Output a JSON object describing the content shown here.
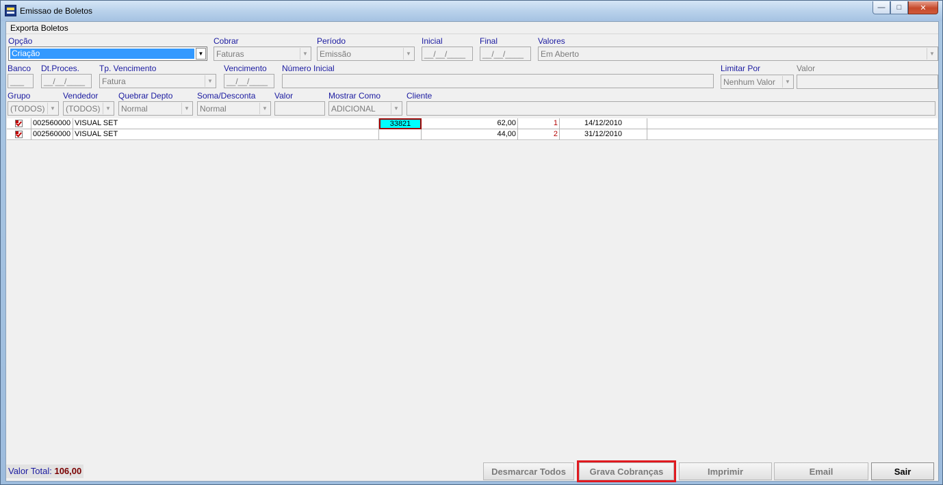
{
  "window": {
    "title": "Emissao de Boletos"
  },
  "menu": {
    "items": [
      {
        "label": "Exporta Boletos"
      }
    ]
  },
  "filters": {
    "opcao": {
      "label": "Opção",
      "value": "Criação"
    },
    "cobrar": {
      "label": "Cobrar",
      "value": "Faturas"
    },
    "periodo": {
      "label": "Período",
      "value": "Emissão"
    },
    "inicial": {
      "label": "Inicial",
      "value": "__/__/____"
    },
    "final": {
      "label": "Final",
      "value": "__/__/____"
    },
    "valores": {
      "label": "Valores",
      "value": "Em Aberto"
    },
    "banco": {
      "label": "Banco",
      "value": "___"
    },
    "dt_proces": {
      "label": "Dt.Proces.",
      "value": "__/__/____"
    },
    "tp_vencimento": {
      "label": "Tp. Vencimento",
      "value": "Fatura"
    },
    "vencimento": {
      "label": "Vencimento",
      "value": "__/__/____"
    },
    "numero_inicial": {
      "label": "Número Inicial",
      "value": ""
    },
    "limitar_por": {
      "label": "Limitar Por",
      "value": "Nenhum Valor"
    },
    "valor_limit": {
      "label": "Valor",
      "value": ""
    },
    "grupo": {
      "label": "Grupo",
      "value": "(TODOS)"
    },
    "vendedor": {
      "label": "Vendedor",
      "value": "(TODOS)"
    },
    "quebrar_depto": {
      "label": "Quebrar Depto",
      "value": "Normal"
    },
    "soma_desconta": {
      "label": "Soma/Desconta",
      "value": "Normal"
    },
    "valor": {
      "label": "Valor",
      "value": ""
    },
    "mostrar_como": {
      "label": "Mostrar Como",
      "value": "ADICIONAL"
    },
    "cliente": {
      "label": "Cliente",
      "value": ""
    }
  },
  "rows": [
    {
      "code": "002560000",
      "name": "VISUAL SET",
      "doc": "33821",
      "amount": "62,00",
      "seq": "1",
      "date": "14/12/2010"
    },
    {
      "code": "002560000",
      "name": "VISUAL SET",
      "doc": "",
      "amount": "44,00",
      "seq": "2",
      "date": "31/12/2010"
    }
  ],
  "footer": {
    "total_label": "Valor Total:",
    "total_value": "106,00",
    "buttons": {
      "desmarcar": "Desmarcar Todos",
      "grava": "Grava Cobranças",
      "imprimir": "Imprimir",
      "email": "Email",
      "sair": "Sair"
    }
  }
}
